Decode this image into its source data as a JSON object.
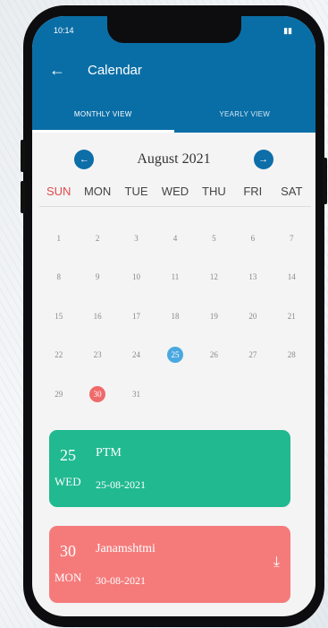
{
  "status": {
    "time": "10:14"
  },
  "appbar": {
    "title": "Calendar",
    "back_icon": "arrow-left-icon"
  },
  "tabs": [
    {
      "label": "MONTHLY VIEW",
      "active": true
    },
    {
      "label": "YEARLY VIEW",
      "active": false
    }
  ],
  "calendar": {
    "month_label": "August 2021",
    "prev_icon": "arrow-left-icon",
    "next_icon": "arrow-right-icon",
    "weekdays": [
      "SUN",
      "MON",
      "TUE",
      "WED",
      "THU",
      "FRI",
      "SAT"
    ],
    "weeks": [
      [
        "1",
        "2",
        "3",
        "4",
        "5",
        "6",
        "7"
      ],
      [
        "8",
        "9",
        "10",
        "11",
        "12",
        "13",
        "14"
      ],
      [
        "15",
        "16",
        "17",
        "18",
        "19",
        "20",
        "21"
      ],
      [
        "22",
        "23",
        "24",
        "25",
        "26",
        "27",
        "28"
      ],
      [
        "29",
        "30",
        "31",
        "",
        "",
        "",
        ""
      ]
    ],
    "today": "25",
    "holiday": "30",
    "colors": {
      "today": "#4aa8e0",
      "holiday": "#ef6b6b",
      "sunday": "#e04a4a"
    }
  },
  "events": [
    {
      "day": "25",
      "weekday": "WED",
      "title": "PTM",
      "date": "25-08-2021",
      "color": "#20b990"
    },
    {
      "day": "30",
      "weekday": "MON",
      "title": "Janamshtmi",
      "date": "30-08-2021",
      "color": "#f57b7b",
      "icon": "download-icon"
    }
  ],
  "colors": {
    "primary": "#0a6ea6"
  }
}
